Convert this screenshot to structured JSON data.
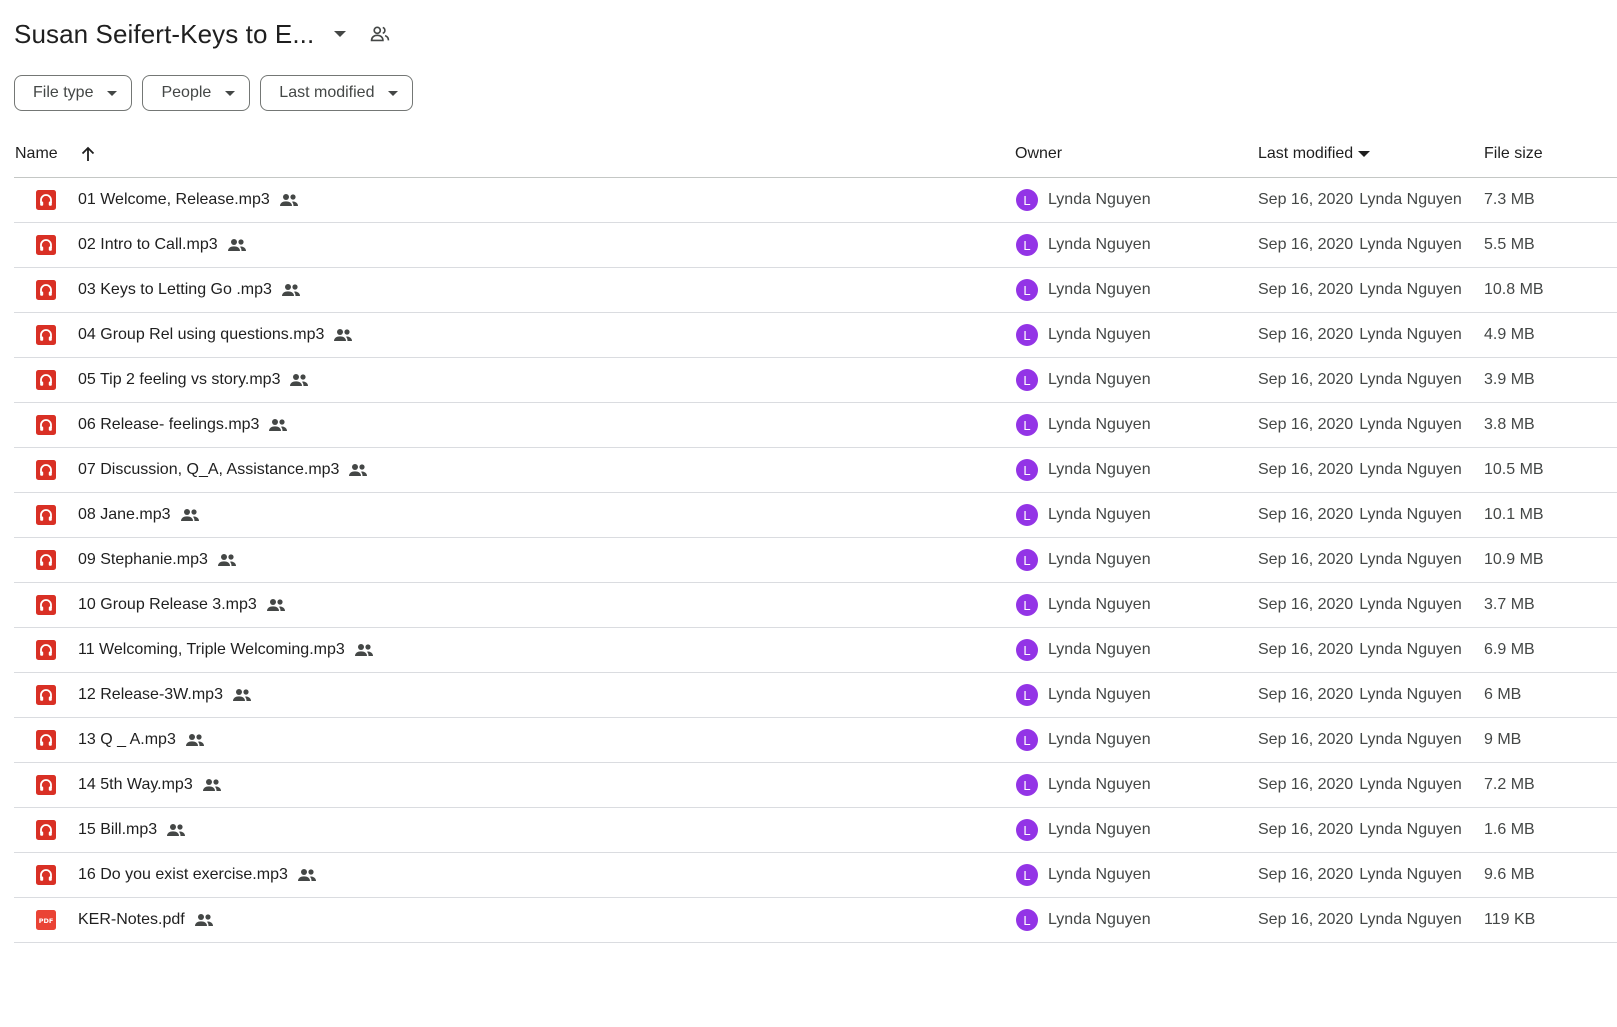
{
  "header": {
    "folder_title": "Susan Seifert-Keys to E...",
    "caret_icon": "arrow-drop-down-icon",
    "share_icon": "shared-people-icon"
  },
  "filters": [
    {
      "label": "File type"
    },
    {
      "label": "People"
    },
    {
      "label": "Last modified"
    }
  ],
  "table": {
    "columns": {
      "name": "Name",
      "owner": "Owner",
      "last_modified": "Last modified",
      "file_size": "File size"
    },
    "sort": {
      "column": "Name",
      "direction": "ascending"
    },
    "rows": [
      {
        "name": "01 Welcome, Release.mp3",
        "type": "audio",
        "owner_initial": "L",
        "owner": "Lynda Nguyen",
        "date": "Sep 16, 2020",
        "modified_by": "Lynda Nguyen",
        "size": "7.3 MB"
      },
      {
        "name": "02 Intro to Call.mp3",
        "type": "audio",
        "owner_initial": "L",
        "owner": "Lynda Nguyen",
        "date": "Sep 16, 2020",
        "modified_by": "Lynda Nguyen",
        "size": "5.5 MB"
      },
      {
        "name": "03 Keys to Letting Go .mp3",
        "type": "audio",
        "owner_initial": "L",
        "owner": "Lynda Nguyen",
        "date": "Sep 16, 2020",
        "modified_by": "Lynda Nguyen",
        "size": "10.8 MB"
      },
      {
        "name": "04 Group Rel using questions.mp3",
        "type": "audio",
        "owner_initial": "L",
        "owner": "Lynda Nguyen",
        "date": "Sep 16, 2020",
        "modified_by": "Lynda Nguyen",
        "size": "4.9 MB"
      },
      {
        "name": "05 Tip 2 feeling vs story.mp3",
        "type": "audio",
        "owner_initial": "L",
        "owner": "Lynda Nguyen",
        "date": "Sep 16, 2020",
        "modified_by": "Lynda Nguyen",
        "size": "3.9 MB"
      },
      {
        "name": "06 Release- feelings.mp3",
        "type": "audio",
        "owner_initial": "L",
        "owner": "Lynda Nguyen",
        "date": "Sep 16, 2020",
        "modified_by": "Lynda Nguyen",
        "size": "3.8 MB"
      },
      {
        "name": "07 Discussion, Q_A, Assistance.mp3",
        "type": "audio",
        "owner_initial": "L",
        "owner": "Lynda Nguyen",
        "date": "Sep 16, 2020",
        "modified_by": "Lynda Nguyen",
        "size": "10.5 MB"
      },
      {
        "name": "08 Jane.mp3",
        "type": "audio",
        "owner_initial": "L",
        "owner": "Lynda Nguyen",
        "date": "Sep 16, 2020",
        "modified_by": "Lynda Nguyen",
        "size": "10.1 MB"
      },
      {
        "name": "09 Stephanie.mp3",
        "type": "audio",
        "owner_initial": "L",
        "owner": "Lynda Nguyen",
        "date": "Sep 16, 2020",
        "modified_by": "Lynda Nguyen",
        "size": "10.9 MB"
      },
      {
        "name": "10 Group Release 3.mp3",
        "type": "audio",
        "owner_initial": "L",
        "owner": "Lynda Nguyen",
        "date": "Sep 16, 2020",
        "modified_by": "Lynda Nguyen",
        "size": "3.7 MB"
      },
      {
        "name": "11 Welcoming, Triple Welcoming.mp3",
        "type": "audio",
        "owner_initial": "L",
        "owner": "Lynda Nguyen",
        "date": "Sep 16, 2020",
        "modified_by": "Lynda Nguyen",
        "size": "6.9 MB"
      },
      {
        "name": "12 Release-3W.mp3",
        "type": "audio",
        "owner_initial": "L",
        "owner": "Lynda Nguyen",
        "date": "Sep 16, 2020",
        "modified_by": "Lynda Nguyen",
        "size": "6 MB"
      },
      {
        "name": "13 Q _ A.mp3",
        "type": "audio",
        "owner_initial": "L",
        "owner": "Lynda Nguyen",
        "date": "Sep 16, 2020",
        "modified_by": "Lynda Nguyen",
        "size": "9 MB"
      },
      {
        "name": "14 5th Way.mp3",
        "type": "audio",
        "owner_initial": "L",
        "owner": "Lynda Nguyen",
        "date": "Sep 16, 2020",
        "modified_by": "Lynda Nguyen",
        "size": "7.2 MB"
      },
      {
        "name": "15 Bill.mp3",
        "type": "audio",
        "owner_initial": "L",
        "owner": "Lynda Nguyen",
        "date": "Sep 16, 2020",
        "modified_by": "Lynda Nguyen",
        "size": "1.6 MB"
      },
      {
        "name": "16 Do you exist exercise.mp3",
        "type": "audio",
        "owner_initial": "L",
        "owner": "Lynda Nguyen",
        "date": "Sep 16, 2020",
        "modified_by": "Lynda Nguyen",
        "size": "9.6 MB"
      },
      {
        "name": "KER-Notes.pdf",
        "type": "pdf",
        "owner_initial": "L",
        "owner": "Lynda Nguyen",
        "date": "Sep 16, 2020",
        "modified_by": "Lynda Nguyen",
        "size": "119 KB"
      }
    ]
  },
  "colors": {
    "audio_icon": "#d93025",
    "pdf_icon": "#ea4335",
    "avatar": "#9334e6",
    "divider": "#dadce0"
  }
}
